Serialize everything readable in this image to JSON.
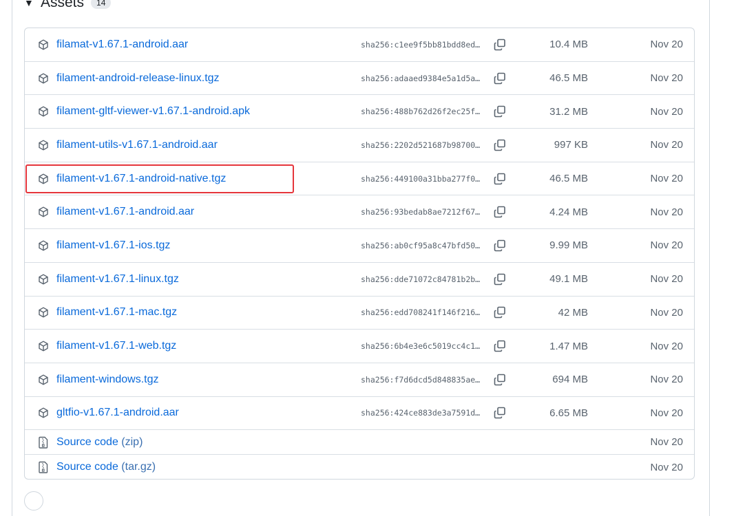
{
  "section": {
    "title": "Assets",
    "count": "14"
  },
  "assets": [
    {
      "name": "filamat-v1.67.1-android.aar",
      "sha": "sha256:c1ee9f5bb81bdd8ed…",
      "size": "10.4 MB",
      "date": "Nov 20"
    },
    {
      "name": "filament-android-release-linux.tgz",
      "sha": "sha256:adaaed9384e5a1d5a…",
      "size": "46.5 MB",
      "date": "Nov 20"
    },
    {
      "name": "filament-gltf-viewer-v1.67.1-android.apk",
      "sha": "sha256:488b762d26f2ec25f…",
      "size": "31.2 MB",
      "date": "Nov 20"
    },
    {
      "name": "filament-utils-v1.67.1-android.aar",
      "sha": "sha256:2202d521687b98700…",
      "size": "997 KB",
      "date": "Nov 20"
    },
    {
      "name": "filament-v1.67.1-android-native.tgz",
      "sha": "sha256:449100a31bba277f0…",
      "size": "46.5 MB",
      "date": "Nov 20"
    },
    {
      "name": "filament-v1.67.1-android.aar",
      "sha": "sha256:93bedab8ae7212f67…",
      "size": "4.24 MB",
      "date": "Nov 20"
    },
    {
      "name": "filament-v1.67.1-ios.tgz",
      "sha": "sha256:ab0cf95a8c47bfd50…",
      "size": "9.99 MB",
      "date": "Nov 20"
    },
    {
      "name": "filament-v1.67.1-linux.tgz",
      "sha": "sha256:dde71072c84781b2b…",
      "size": "49.1 MB",
      "date": "Nov 20"
    },
    {
      "name": "filament-v1.67.1-mac.tgz",
      "sha": "sha256:edd708241f146f216…",
      "size": "42 MB",
      "date": "Nov 20"
    },
    {
      "name": "filament-v1.67.1-web.tgz",
      "sha": "sha256:6b4e3e6c5019cc4c1…",
      "size": "1.47 MB",
      "date": "Nov 20"
    },
    {
      "name": "filament-windows.tgz",
      "sha": "sha256:f7d6dcd5d848835ae…",
      "size": "694 MB",
      "date": "Nov 20"
    },
    {
      "name": "gltfio-v1.67.1-android.aar",
      "sha": "sha256:424ce883de3a7591d…",
      "size": "6.65 MB",
      "date": "Nov 20"
    }
  ],
  "source": [
    {
      "label": "Source code",
      "format": "(zip)",
      "date": "Nov 20"
    },
    {
      "label": "Source code",
      "format": "(tar.gz)",
      "date": "Nov 20"
    }
  ],
  "colors": {
    "link": "#0969da",
    "highlight": "#e5353b"
  }
}
